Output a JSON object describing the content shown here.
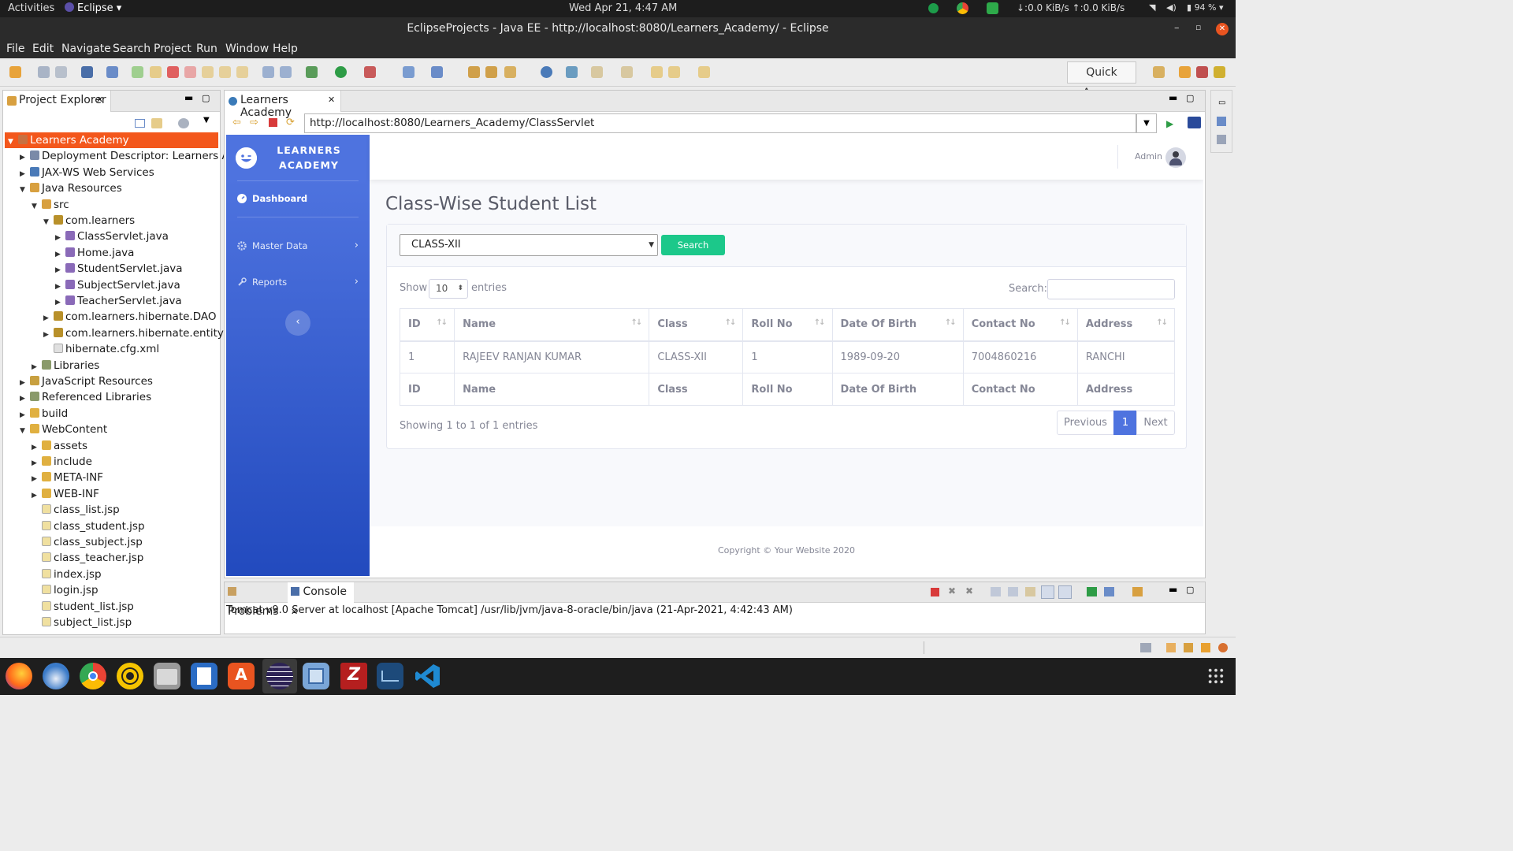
{
  "topbar": {
    "activities": "Activities",
    "app": "Eclipse",
    "clock": "Wed Apr 21,  4:47 AM",
    "net": "↓:0.0 KiB/s ↑:0.0 KiB/s",
    "battery": "94 %"
  },
  "window": {
    "title": "EclipseProjects - Java EE - http://localhost:8080/Learners_Academy/ - Eclipse"
  },
  "menu": [
    "File",
    "Edit",
    "Navigate",
    "Search",
    "Project",
    "Run",
    "Window",
    "Help"
  ],
  "toolbar": {
    "quick_access": "Quick Access"
  },
  "explorer": {
    "tab": "Project Explorer",
    "tree": [
      {
        "label": "Learners Academy",
        "depth": 0,
        "exp": "▼",
        "sel": true
      },
      {
        "label": "Deployment Descriptor: Learners Acad",
        "depth": 1,
        "exp": "▶"
      },
      {
        "label": "JAX-WS Web Services",
        "depth": 1,
        "exp": "▶"
      },
      {
        "label": "Java Resources",
        "depth": 1,
        "exp": "▼"
      },
      {
        "label": "src",
        "depth": 2,
        "exp": "▼"
      },
      {
        "label": "com.learners",
        "depth": 3,
        "exp": "▼"
      },
      {
        "label": "ClassServlet.java",
        "depth": 4,
        "exp": "▶"
      },
      {
        "label": "Home.java",
        "depth": 4,
        "exp": "▶"
      },
      {
        "label": "StudentServlet.java",
        "depth": 4,
        "exp": "▶"
      },
      {
        "label": "SubjectServlet.java",
        "depth": 4,
        "exp": "▶"
      },
      {
        "label": "TeacherServlet.java",
        "depth": 4,
        "exp": "▶"
      },
      {
        "label": "com.learners.hibernate.DAO",
        "depth": 3,
        "exp": "▶"
      },
      {
        "label": "com.learners.hibernate.entity",
        "depth": 3,
        "exp": "▶"
      },
      {
        "label": "hibernate.cfg.xml",
        "depth": 3,
        "exp": ""
      },
      {
        "label": "Libraries",
        "depth": 2,
        "exp": "▶"
      },
      {
        "label": "JavaScript Resources",
        "depth": 1,
        "exp": "▶"
      },
      {
        "label": "Referenced Libraries",
        "depth": 1,
        "exp": "▶"
      },
      {
        "label": "build",
        "depth": 1,
        "exp": "▶"
      },
      {
        "label": "WebContent",
        "depth": 1,
        "exp": "▼"
      },
      {
        "label": "assets",
        "depth": 2,
        "exp": "▶"
      },
      {
        "label": "include",
        "depth": 2,
        "exp": "▶"
      },
      {
        "label": "META-INF",
        "depth": 2,
        "exp": "▶"
      },
      {
        "label": "WEB-INF",
        "depth": 2,
        "exp": "▶"
      },
      {
        "label": "class_list.jsp",
        "depth": 2,
        "exp": ""
      },
      {
        "label": "class_student.jsp",
        "depth": 2,
        "exp": ""
      },
      {
        "label": "class_subject.jsp",
        "depth": 2,
        "exp": ""
      },
      {
        "label": "class_teacher.jsp",
        "depth": 2,
        "exp": ""
      },
      {
        "label": "index.jsp",
        "depth": 2,
        "exp": ""
      },
      {
        "label": "login.jsp",
        "depth": 2,
        "exp": ""
      },
      {
        "label": "student_list.jsp",
        "depth": 2,
        "exp": ""
      },
      {
        "label": "subject_list.jsp",
        "depth": 2,
        "exp": ""
      }
    ]
  },
  "editor": {
    "tab": "Learners Academy",
    "url": "http://localhost:8080/Learners_Academy/ClassServlet"
  },
  "web": {
    "brand_line1": "LEARNERS",
    "brand_line2": "ACADEMY",
    "nav": {
      "dashboard": "Dashboard",
      "master": "Master Data",
      "reports": "Reports"
    },
    "user": "Admin",
    "heading": "Class-Wise Student List",
    "class_select": "CLASS-XII",
    "search_button": "Search",
    "show": "Show",
    "length": "10",
    "entries": "entries",
    "search_label": "Search:",
    "columns": [
      "ID",
      "Name",
      "Class",
      "Roll No",
      "Date Of Birth",
      "Contact No",
      "Address"
    ],
    "rows": [
      [
        "1",
        "RAJEEV RANJAN KUMAR",
        "CLASS-XII",
        "1",
        "1989-09-20",
        "7004860216",
        "RANCHI"
      ]
    ],
    "info": "Showing 1 to 1 of 1 entries",
    "pager": {
      "prev": "Previous",
      "page": "1",
      "next": "Next"
    },
    "footer": "Copyright © Your Website 2020",
    "colors": {
      "sidebar": "#4e73df",
      "success": "#1cc88a",
      "primary": "#4e73df"
    }
  },
  "console": {
    "problems_tab": "Problems",
    "console_tab": "Console",
    "line": "Tomcat v9.0 Server at localhost [Apache Tomcat] /usr/lib/jvm/java-8-oracle/bin/java (21-Apr-2021, 4:42:43 AM)"
  },
  "dock": [
    "firefox-icon",
    "thunderbird-icon",
    "chrome-icon",
    "rhythmbox-icon",
    "files-icon",
    "writer-icon",
    "software-center-icon",
    "eclipse-icon",
    "virtualbox-icon",
    "filezilla-icon",
    "mysql-workbench-icon",
    "vscode-icon"
  ]
}
